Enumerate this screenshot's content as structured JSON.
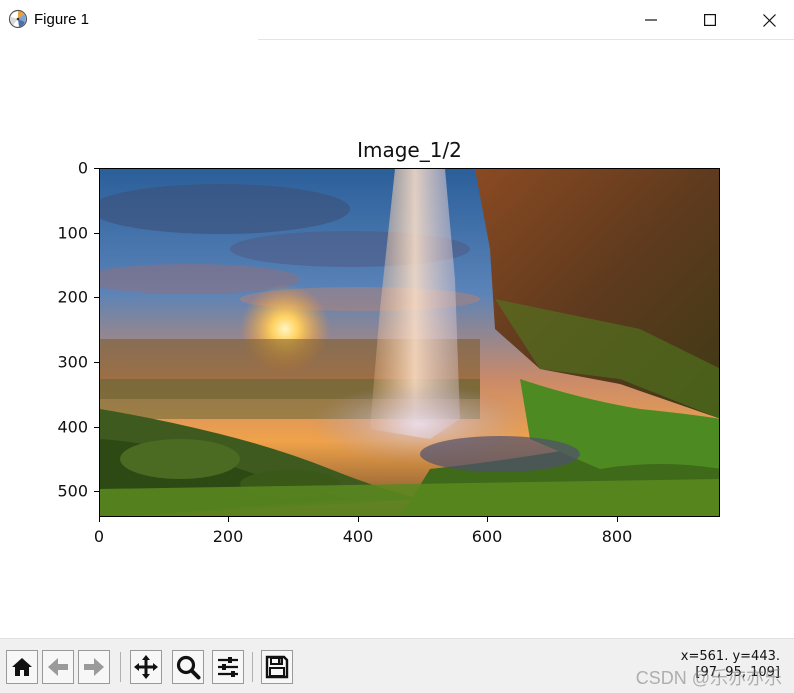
{
  "window": {
    "title": "Figure 1",
    "controls": [
      "minimize-icon",
      "maximize-icon",
      "close-icon"
    ]
  },
  "chart_data": {
    "type": "image",
    "title": "Image_1/2",
    "xlim": [
      0,
      960
    ],
    "ylim": [
      540,
      0
    ],
    "x_ticks": [
      0,
      200,
      400,
      600,
      800
    ],
    "y_ticks": [
      0,
      100,
      200,
      300,
      400,
      500
    ],
    "x_tick_labels": [
      "0",
      "200",
      "400",
      "600",
      "800"
    ],
    "y_tick_labels": [
      "0",
      "100",
      "200",
      "300",
      "400",
      "500"
    ],
    "content": "photo-of-waterfall-at-sunset"
  },
  "toolbar": {
    "buttons": [
      "home-icon",
      "back-icon",
      "forward-icon",
      "pan-icon",
      "zoom-icon",
      "configure-subplots-icon",
      "save-icon"
    ],
    "coords_line1": "x=561. y=443.",
    "coords_line2": "[97, 95, 109]"
  },
  "watermark": "CSDN @乐亦亦乐"
}
